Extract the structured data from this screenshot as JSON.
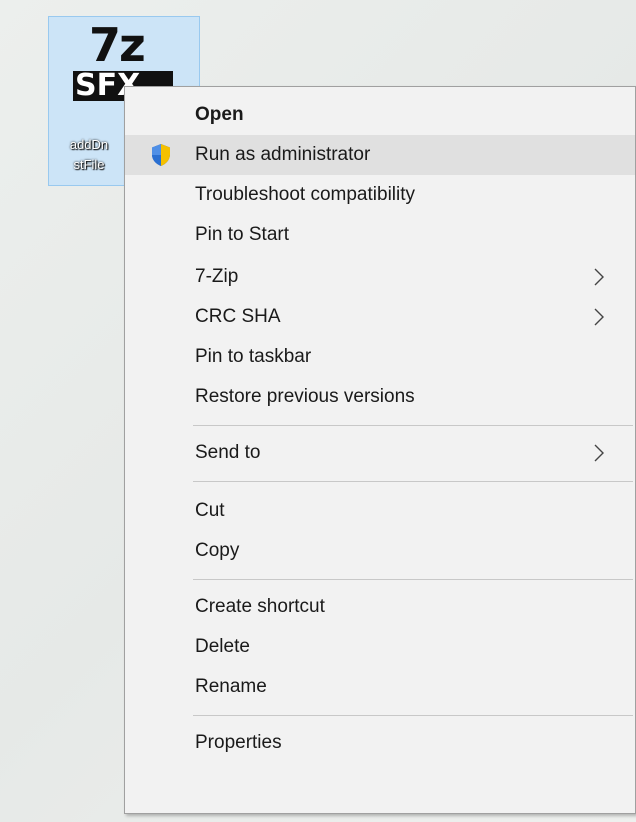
{
  "desktop": {
    "icon": {
      "graphic_top": "7z",
      "graphic_bottom": "SFX",
      "label_line1": "addDn",
      "label_line2": "stFile"
    }
  },
  "context_menu": {
    "items": [
      {
        "label": "Open",
        "bold": true
      },
      {
        "label": "Run as administrator",
        "icon": "uac-shield-icon",
        "highlighted": true
      },
      {
        "label": "Troubleshoot compatibility"
      },
      {
        "label": "Pin to Start"
      },
      {
        "label": "7-Zip",
        "submenu": true
      },
      {
        "label": "CRC SHA",
        "submenu": true
      },
      {
        "label": "Pin to taskbar"
      },
      {
        "label": "Restore previous versions"
      },
      {
        "label": "Send to",
        "submenu": true
      },
      {
        "label": "Cut"
      },
      {
        "label": "Copy"
      },
      {
        "label": "Create shortcut"
      },
      {
        "label": "Delete"
      },
      {
        "label": "Rename"
      },
      {
        "label": "Properties"
      }
    ]
  },
  "colors": {
    "menu_background": "#f2f2f2",
    "menu_highlight": "#e0e0e0",
    "icon_selection": "#cce4f7",
    "shield_blue": "#1f5fbf",
    "shield_yellow": "#f5c000"
  }
}
